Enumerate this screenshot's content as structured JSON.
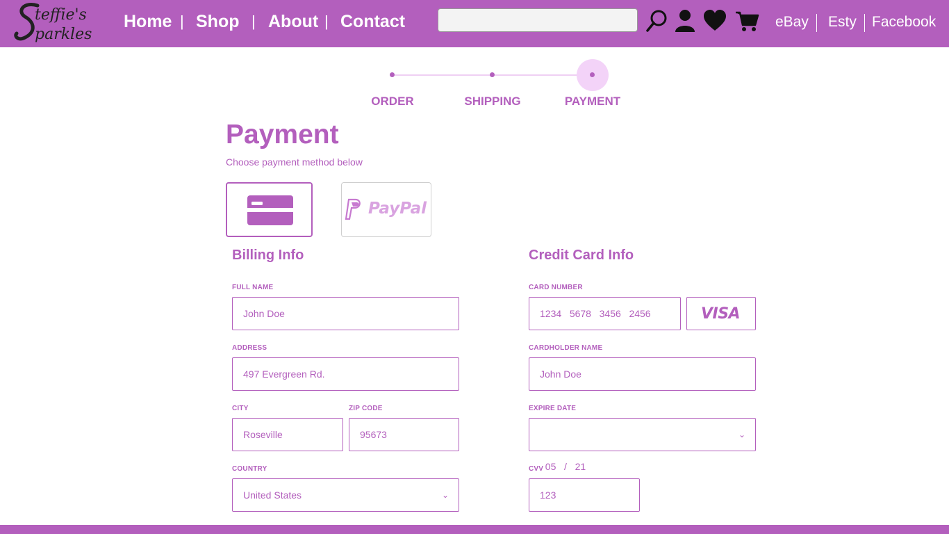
{
  "brand": {
    "logo_text": "Steffie's Sparkles",
    "color": "#b35fbd"
  },
  "nav": {
    "home": "Home",
    "shop": "Shop",
    "about": "About",
    "contact": "Contact",
    "separator": "|"
  },
  "search": {
    "placeholder": "",
    "icon": "search-icon"
  },
  "header_icons": [
    "user-icon",
    "heart-icon",
    "cart-icon"
  ],
  "external_links": {
    "ebay": "eBay",
    "esty": "Esty",
    "facebook": "Facebook"
  },
  "steps": {
    "order": "ORDER",
    "shipping": "SHIPPING",
    "payment": "PAYMENT",
    "active": "PAYMENT"
  },
  "page": {
    "title": "Payment",
    "subtitle": "Choose payment method below"
  },
  "payment_methods": {
    "card_icon": "credit-card-icon",
    "paypal": "PayPal",
    "selected": "credit-card"
  },
  "billing": {
    "title": "Billing Info",
    "full_name_label": "FULL NAME",
    "full_name": "John Doe",
    "address_label": "ADDRESS",
    "address": "497 Evergreen Rd.",
    "city_label": "CITY",
    "city": "Roseville",
    "zip_label": "ZIP CODE",
    "zip": "95673",
    "country_label": "COUNTRY",
    "country": "United States"
  },
  "card": {
    "title": "Credit Card Info",
    "number_label": "CARD NUMBER",
    "number": "1234   5678   3456   2456",
    "brand": "VISA",
    "holder_label": "CARDHOLDER NAME",
    "holder": "John Doe",
    "expire_label": "EXPIRE DATE",
    "expire": "05   /   21",
    "cvv_label": "CVV",
    "cvv": "123"
  }
}
